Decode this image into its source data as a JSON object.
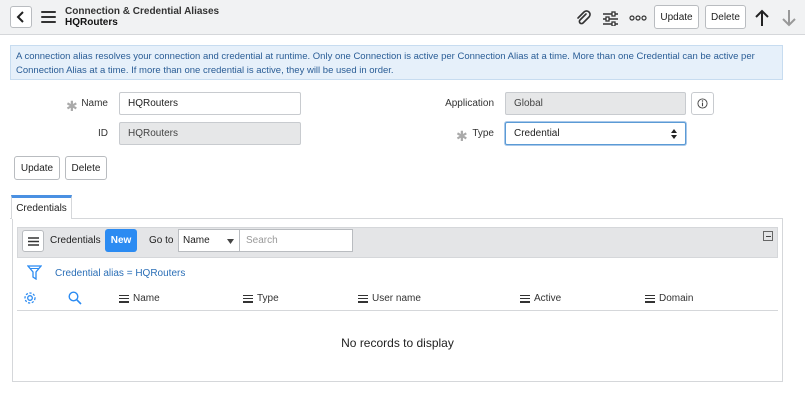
{
  "header": {
    "title": "Connection & Credential Aliases",
    "subtitle": "HQRouters",
    "update_label": "Update",
    "delete_label": "Delete"
  },
  "banner": {
    "text": "A connection alias resolves your connection and credential at runtime. Only one Connection is active per Connection Alias at a time. More than one Credential can be active per Connection Alias at a time. If more than one credential is active, they will be used in order."
  },
  "form": {
    "name_label": "Name",
    "name_value": "HQRouters",
    "id_label": "ID",
    "id_value": "HQRouters",
    "application_label": "Application",
    "application_value": "Global",
    "type_label": "Type",
    "type_value": "Credential",
    "update_label": "Update",
    "delete_label": "Delete"
  },
  "tabs": [
    {
      "label": "Credentials"
    }
  ],
  "list": {
    "title": "Credentials",
    "new_label": "New",
    "goto_label": "Go to",
    "goto_field": "Name",
    "search_placeholder": "Search",
    "filter": "Credential alias = HQRouters",
    "columns": [
      "Name",
      "Type",
      "User name",
      "Active",
      "Domain"
    ],
    "empty_message": "No records to display"
  },
  "colors": {
    "accent": "#2b8bf2",
    "banner_bg": "#e6f0fa",
    "banner_text": "#2a5d96",
    "link": "#2b6fb7"
  }
}
